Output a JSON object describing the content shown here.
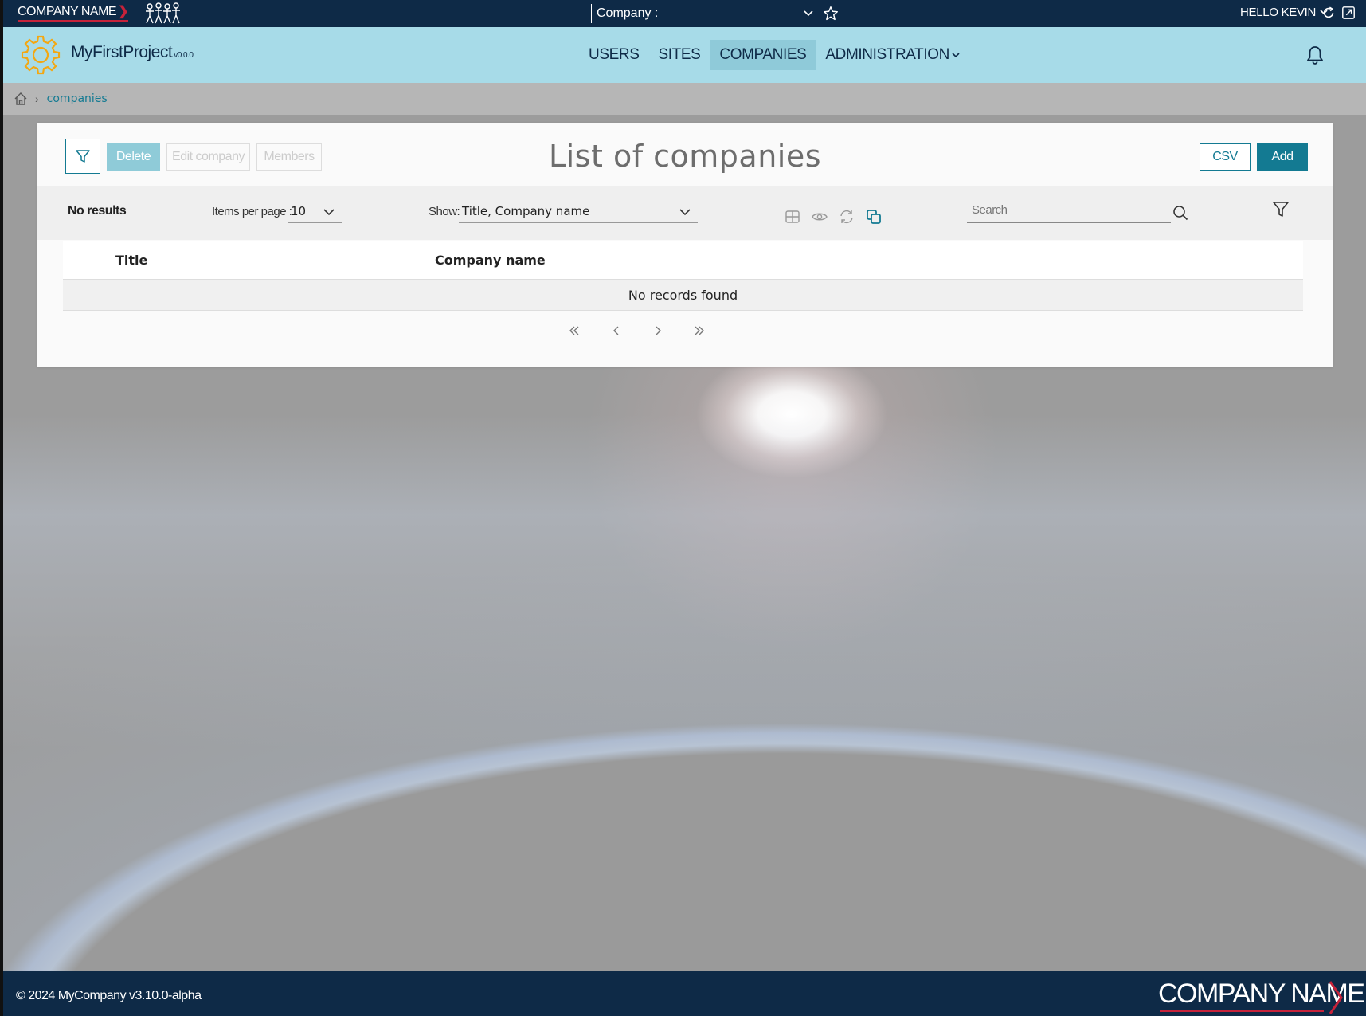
{
  "topbar": {
    "brand": "COMPANY NAME",
    "company_label": "Company :",
    "company_value": "",
    "user_greeting": "HELLO KEVIN"
  },
  "navbar": {
    "project_name": "MyFirstProject",
    "project_version": "v0.0.0",
    "items": [
      {
        "label": "USERS",
        "active": false
      },
      {
        "label": "SITES",
        "active": false
      },
      {
        "label": "COMPANIES",
        "active": true
      },
      {
        "label": "ADMINISTRATION",
        "active": false,
        "has_dropdown": true
      }
    ]
  },
  "breadcrumb": {
    "current": "companies"
  },
  "card": {
    "title": "List of companies",
    "buttons": {
      "delete": "Delete",
      "edit": "Edit company",
      "members": "Members",
      "csv": "CSV",
      "add": "Add"
    },
    "toolbar": {
      "results": "No results",
      "items_per_page_label": "Items per page :",
      "items_per_page_value": "10",
      "show_label": "Show:",
      "show_value": "Title, Company name",
      "search_placeholder": "Search"
    },
    "table": {
      "columns": [
        "Title",
        "Company name"
      ],
      "empty_message": "No records found"
    }
  },
  "footer": {
    "copyright": "© 2024 MyCompany v3.10.0-alpha",
    "brand": "COMPANY NAME"
  },
  "colors": {
    "header_dark": "#0e2a47",
    "nav_light": "#a7dbe8",
    "accent": "#137a92",
    "brand_red": "#c6223a"
  }
}
